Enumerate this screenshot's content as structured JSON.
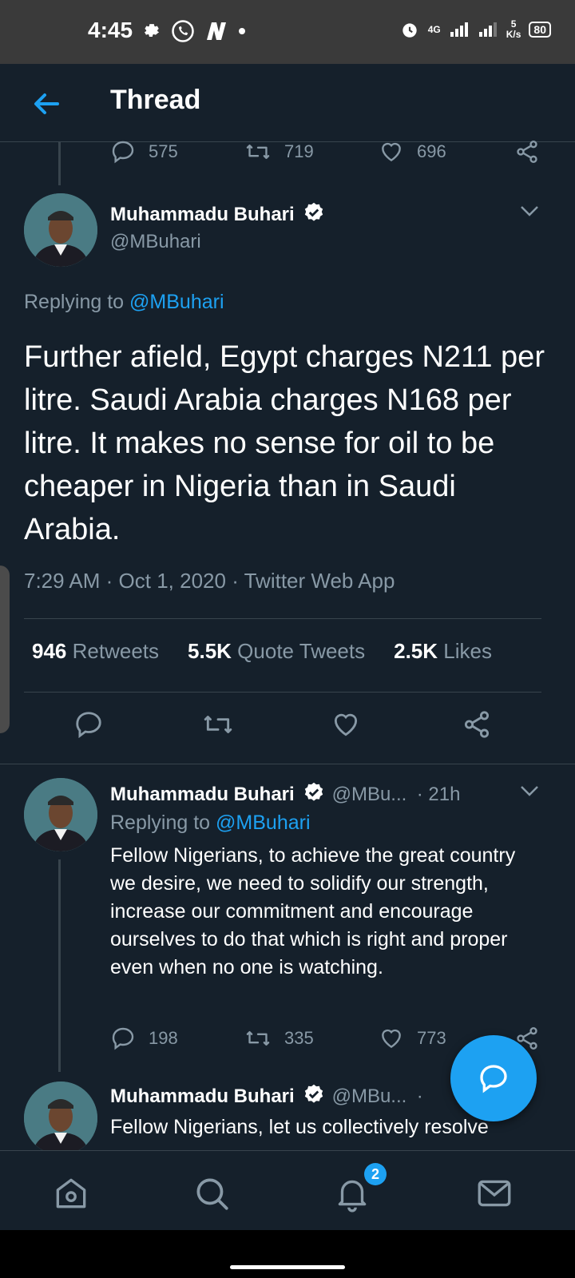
{
  "status_bar": {
    "time": "4:45",
    "network": "4G",
    "speed_value": "5",
    "speed_unit": "K/s",
    "battery": "80"
  },
  "header": {
    "title": "Thread"
  },
  "prev_tweet_actions": {
    "replies": "575",
    "retweets": "719",
    "likes": "696"
  },
  "main_tweet": {
    "name": "Muhammadu Buhari",
    "handle": "@MBuhari",
    "replying_prefix": "Replying to",
    "replying_to": "@MBuhari",
    "text": "Further afield, Egypt charges N211 per litre. Saudi Arabia charges N168 per litre. It makes no sense for oil to be cheaper in Nigeria than in Saudi Arabia.",
    "time": "7:29 AM",
    "date": "Oct 1, 2020",
    "source": "Twitter Web App",
    "retweets_count": "946",
    "retweets_label": "Retweets",
    "quotes_count": "5.5K",
    "quotes_label": "Quote Tweets",
    "likes_count": "2.5K",
    "likes_label": "Likes"
  },
  "replies": [
    {
      "name": "Muhammadu Buhari",
      "handle": "@MBu...",
      "time": "· 21h",
      "replying_prefix": "Replying to",
      "replying_to": "@MBuhari",
      "text": "Fellow Nigerians, to achieve the great country we desire, we need to solidify our strength, increase our commitment and encourage ourselves to do that which is right and proper even when no one is watching.",
      "replies": "198",
      "retweets": "335",
      "likes": "773"
    },
    {
      "name": "Muhammadu Buhari",
      "handle": "@MBu...",
      "time": "·",
      "text": "Fellow Nigerians, let us collectively resolve"
    }
  ],
  "bottom_nav": {
    "notifications_badge": "2"
  },
  "colors": {
    "background": "#15202b",
    "accent": "#1da1f2",
    "muted": "#8899a6",
    "divider": "#38444d"
  }
}
